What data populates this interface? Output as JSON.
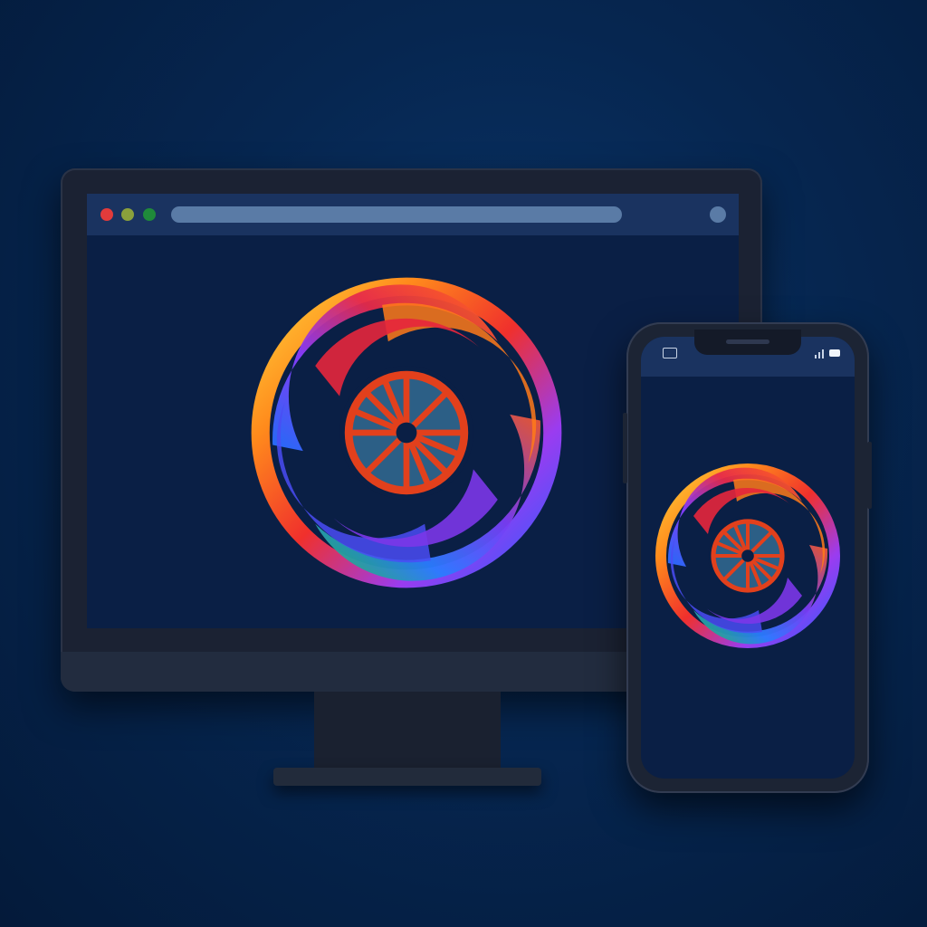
{
  "desktop": {
    "window_controls": [
      {
        "name": "close",
        "color": "#e23b3b"
      },
      {
        "name": "minimize",
        "color": "#8aa03c"
      },
      {
        "name": "maximize",
        "color": "#1f8a3a"
      }
    ],
    "address_bar": {
      "value": ""
    },
    "logo_icon": "swirl-wheel-logo"
  },
  "phone": {
    "status_icons": [
      "camera-icon",
      "signal-icon",
      "battery-icon"
    ],
    "logo_icon": "swirl-wheel-logo"
  },
  "colors": {
    "background": "#062650",
    "screen": "#0a1f45",
    "bar": "#1a3360",
    "wheel": "#e2401c",
    "hub": "#2c5f86"
  }
}
